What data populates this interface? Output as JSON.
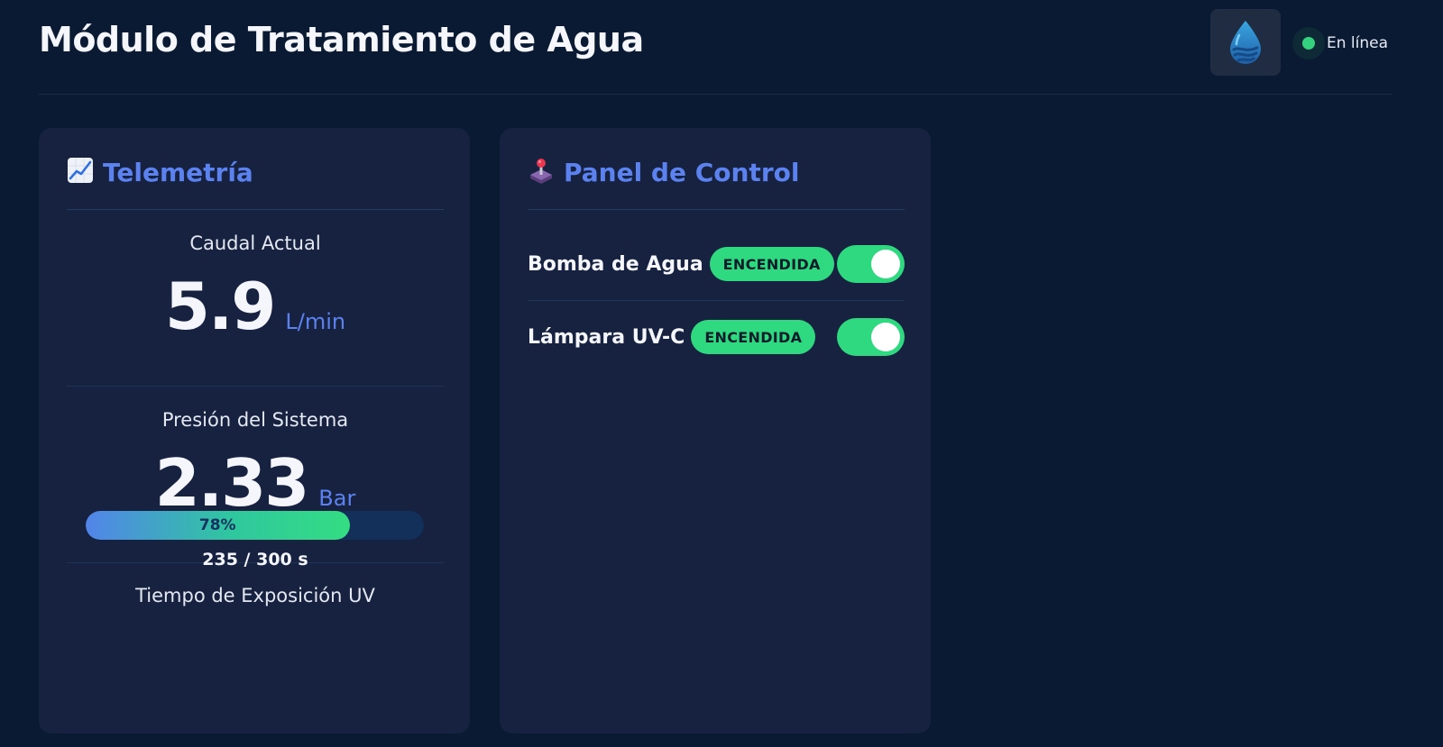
{
  "header": {
    "title": "Módulo de Tratamiento de Agua",
    "logo_icon": "water-drop-icon",
    "status": {
      "label": "En línea",
      "color": "#34d27e"
    }
  },
  "telemetry": {
    "title": "Telemetría",
    "icon": "chart-increasing-icon",
    "flow": {
      "label": "Caudal Actual",
      "value": "5.9",
      "unit": "L/min"
    },
    "pressure": {
      "label": "Presión del Sistema",
      "value": "2.33",
      "unit": "Bar"
    },
    "uv_exposure": {
      "label": "Tiempo de Exposición UV",
      "percent_label": "78%",
      "percent": 78,
      "caption": "235 / 300 s"
    }
  },
  "control": {
    "title": "Panel de Control",
    "icon": "joystick-icon",
    "devices": [
      {
        "label": "Bomba de Agua",
        "status": "ENCENDIDA",
        "on": true
      },
      {
        "label": "Lámpara UV-C",
        "status": "ENCENDIDA",
        "on": true
      }
    ]
  },
  "colors": {
    "background": "#0b1a33",
    "card": "#162240",
    "accent": "#5b82ee",
    "success": "#2fd980"
  }
}
